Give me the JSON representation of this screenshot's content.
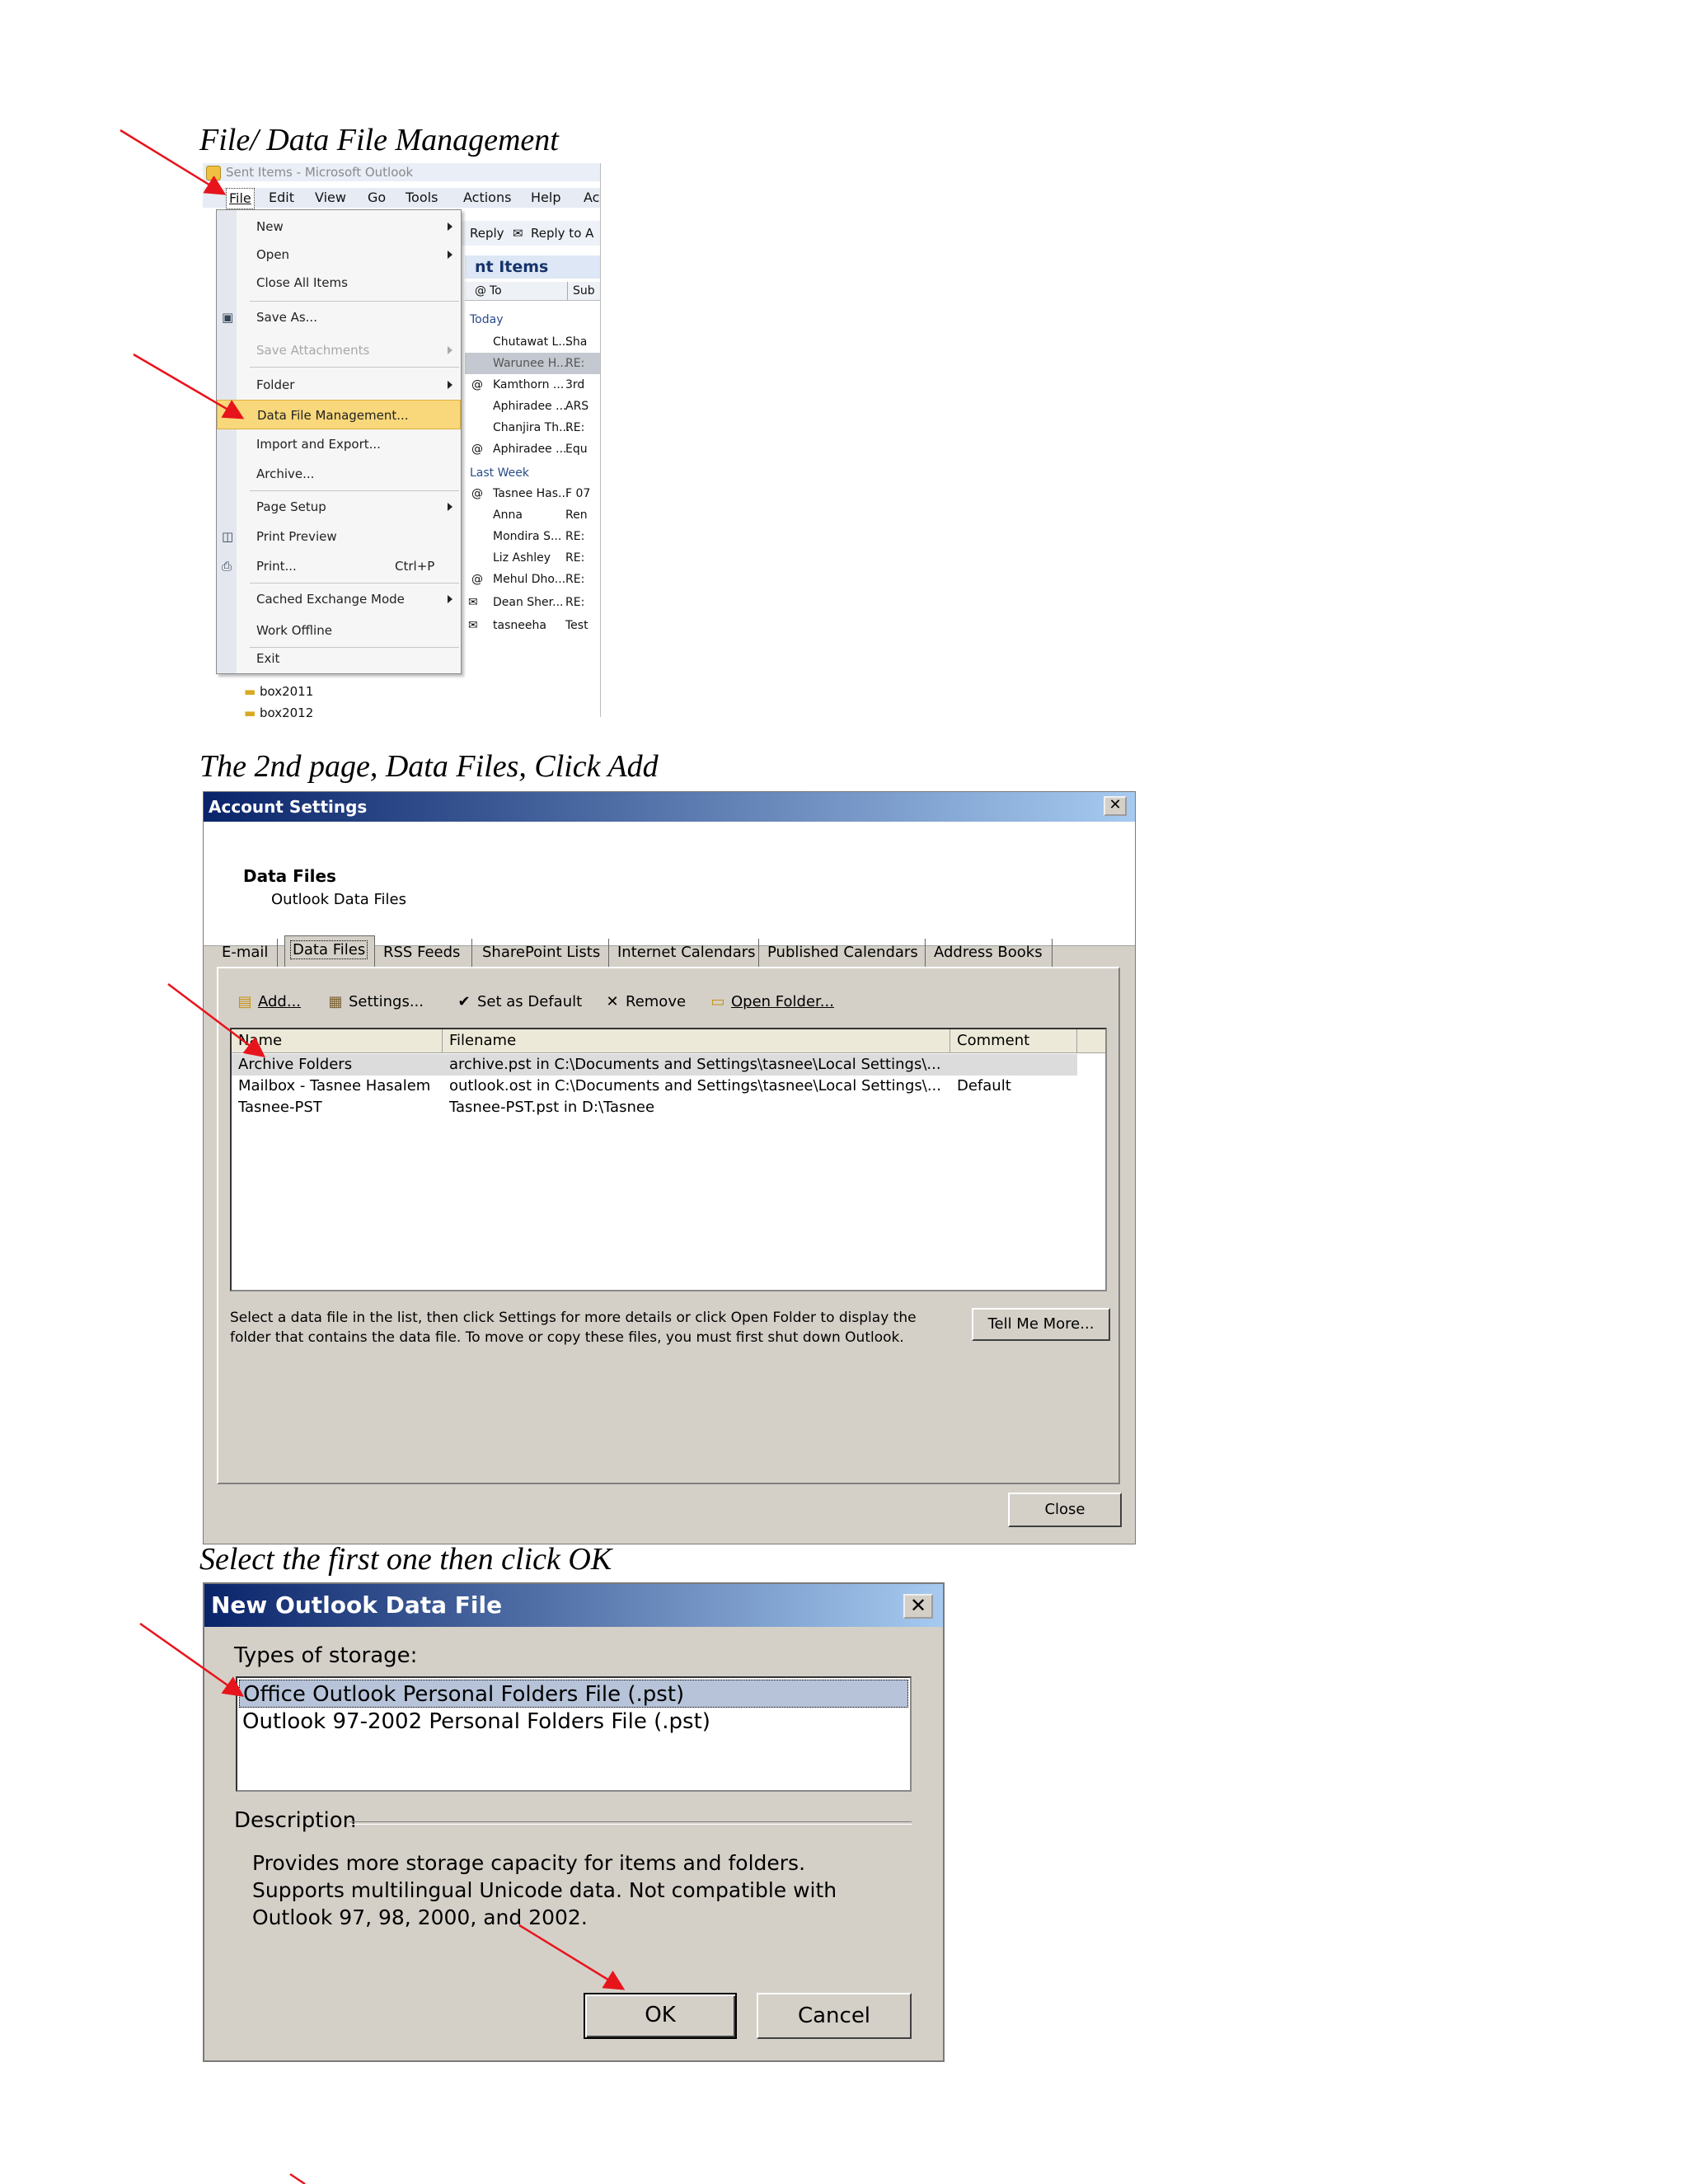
{
  "captions": {
    "step1": "File/ Data File Management",
    "step2": "The 2nd page, Data Files, Click Add",
    "step3": "Select the first one then click OK"
  },
  "outlook": {
    "window_title": "Sent Items - Microsoft Outlook",
    "menubar": [
      "File",
      "Edit",
      "View",
      "Go",
      "Tools",
      "Actions",
      "Help",
      "Ac"
    ],
    "toolbar": {
      "reply": "Reply",
      "reply_all": "Reply to A"
    },
    "pane_title": "nt Items",
    "columns": {
      "to": "To",
      "subject": "Sub"
    },
    "groups": {
      "today": "Today",
      "last_week": "Last Week"
    },
    "messages_today": [
      {
        "from": "Chutawat L...",
        "subject": "Sha"
      },
      {
        "from": "Warunee H...",
        "subject": "RE:"
      },
      {
        "from": "Kamthorn ...",
        "subject": "3rd"
      },
      {
        "from": "Aphiradee ...",
        "subject": "ARS"
      },
      {
        "from": "Chanjira Th...",
        "subject": "RE:"
      },
      {
        "from": "Aphiradee ...",
        "subject": "Equ"
      }
    ],
    "messages_last_week": [
      {
        "from": "Tasnee Has...",
        "subject": "F 07"
      },
      {
        "from": "Anna",
        "subject": "Ren"
      },
      {
        "from": "Mondira S...",
        "subject": "RE:"
      },
      {
        "from": "Liz Ashley",
        "subject": "RE:"
      },
      {
        "from": "Mehul Dho...",
        "subject": "RE:"
      },
      {
        "from": "Dean Sher...",
        "subject": "RE:"
      },
      {
        "from": "tasneeha",
        "subject": "Test"
      }
    ],
    "folders": [
      "box2011",
      "box2012"
    ],
    "file_menu": [
      {
        "label": "New",
        "shortcut": ""
      },
      {
        "label": "Open",
        "shortcut": ""
      },
      {
        "label": "Close All Items",
        "shortcut": ""
      },
      {
        "label": "Save As...",
        "shortcut": ""
      },
      {
        "label": "Save Attachments",
        "shortcut": ""
      },
      {
        "label": "Folder",
        "shortcut": ""
      },
      {
        "label": "Data File Management...",
        "shortcut": ""
      },
      {
        "label": "Import and Export...",
        "shortcut": ""
      },
      {
        "label": "Archive...",
        "shortcut": ""
      },
      {
        "label": "Page Setup",
        "shortcut": ""
      },
      {
        "label": "Print Preview",
        "shortcut": ""
      },
      {
        "label": "Print...",
        "shortcut": "Ctrl+P"
      },
      {
        "label": "Cached Exchange Mode",
        "shortcut": ""
      },
      {
        "label": "Work Offline",
        "shortcut": ""
      },
      {
        "label": "Exit",
        "shortcut": ""
      }
    ]
  },
  "account_settings": {
    "title": "Account Settings",
    "heading": "Data Files",
    "subheading": "Outlook Data Files",
    "tabs": [
      "E-mail",
      "Data Files",
      "RSS Feeds",
      "SharePoint Lists",
      "Internet Calendars",
      "Published Calendars",
      "Address Books"
    ],
    "toolbar": {
      "add": "Add...",
      "settings": "Settings...",
      "set_default": "Set as Default",
      "remove": "Remove",
      "open_folder": "Open Folder..."
    },
    "columns": {
      "name": "Name",
      "filename": "Filename",
      "comment": "Comment"
    },
    "rows": [
      {
        "name": "Archive Folders",
        "filename": "archive.pst in C:\\Documents and Settings\\tasnee\\Local Settings\\...",
        "comment": ""
      },
      {
        "name": "Mailbox - Tasnee Hasalem",
        "filename": "outlook.ost in C:\\Documents and Settings\\tasnee\\Local Settings\\...",
        "comment": "Default"
      },
      {
        "name": "Tasnee-PST",
        "filename": "Tasnee-PST.pst in D:\\Tasnee",
        "comment": ""
      }
    ],
    "help_text": "Select a data file in the list, then click Settings for more details or click Open Folder to display the folder that contains the data file. To move or copy these files, you must first shut down Outlook.",
    "tell_me_more": "Tell Me More...",
    "close": "Close"
  },
  "new_data_file": {
    "title": "New Outlook Data File",
    "types_label": "Types of storage:",
    "types": [
      "Office Outlook Personal Folders File (.pst)",
      "Outlook 97-2002 Personal Folders File (.pst)"
    ],
    "description_label": "Description",
    "description": "Provides more storage capacity for items and folders. Supports multilingual Unicode data. Not compatible with Outlook 97, 98, 2000, and 2002.",
    "ok": "OK",
    "cancel": "Cancel"
  },
  "colors": {
    "arrow": "#e8141c",
    "title_bar_start": "#0a246a",
    "title_bar_end": "#a6caf0",
    "dialog_face": "#d4d0c8",
    "menu_highlight": "#f8d87a"
  }
}
